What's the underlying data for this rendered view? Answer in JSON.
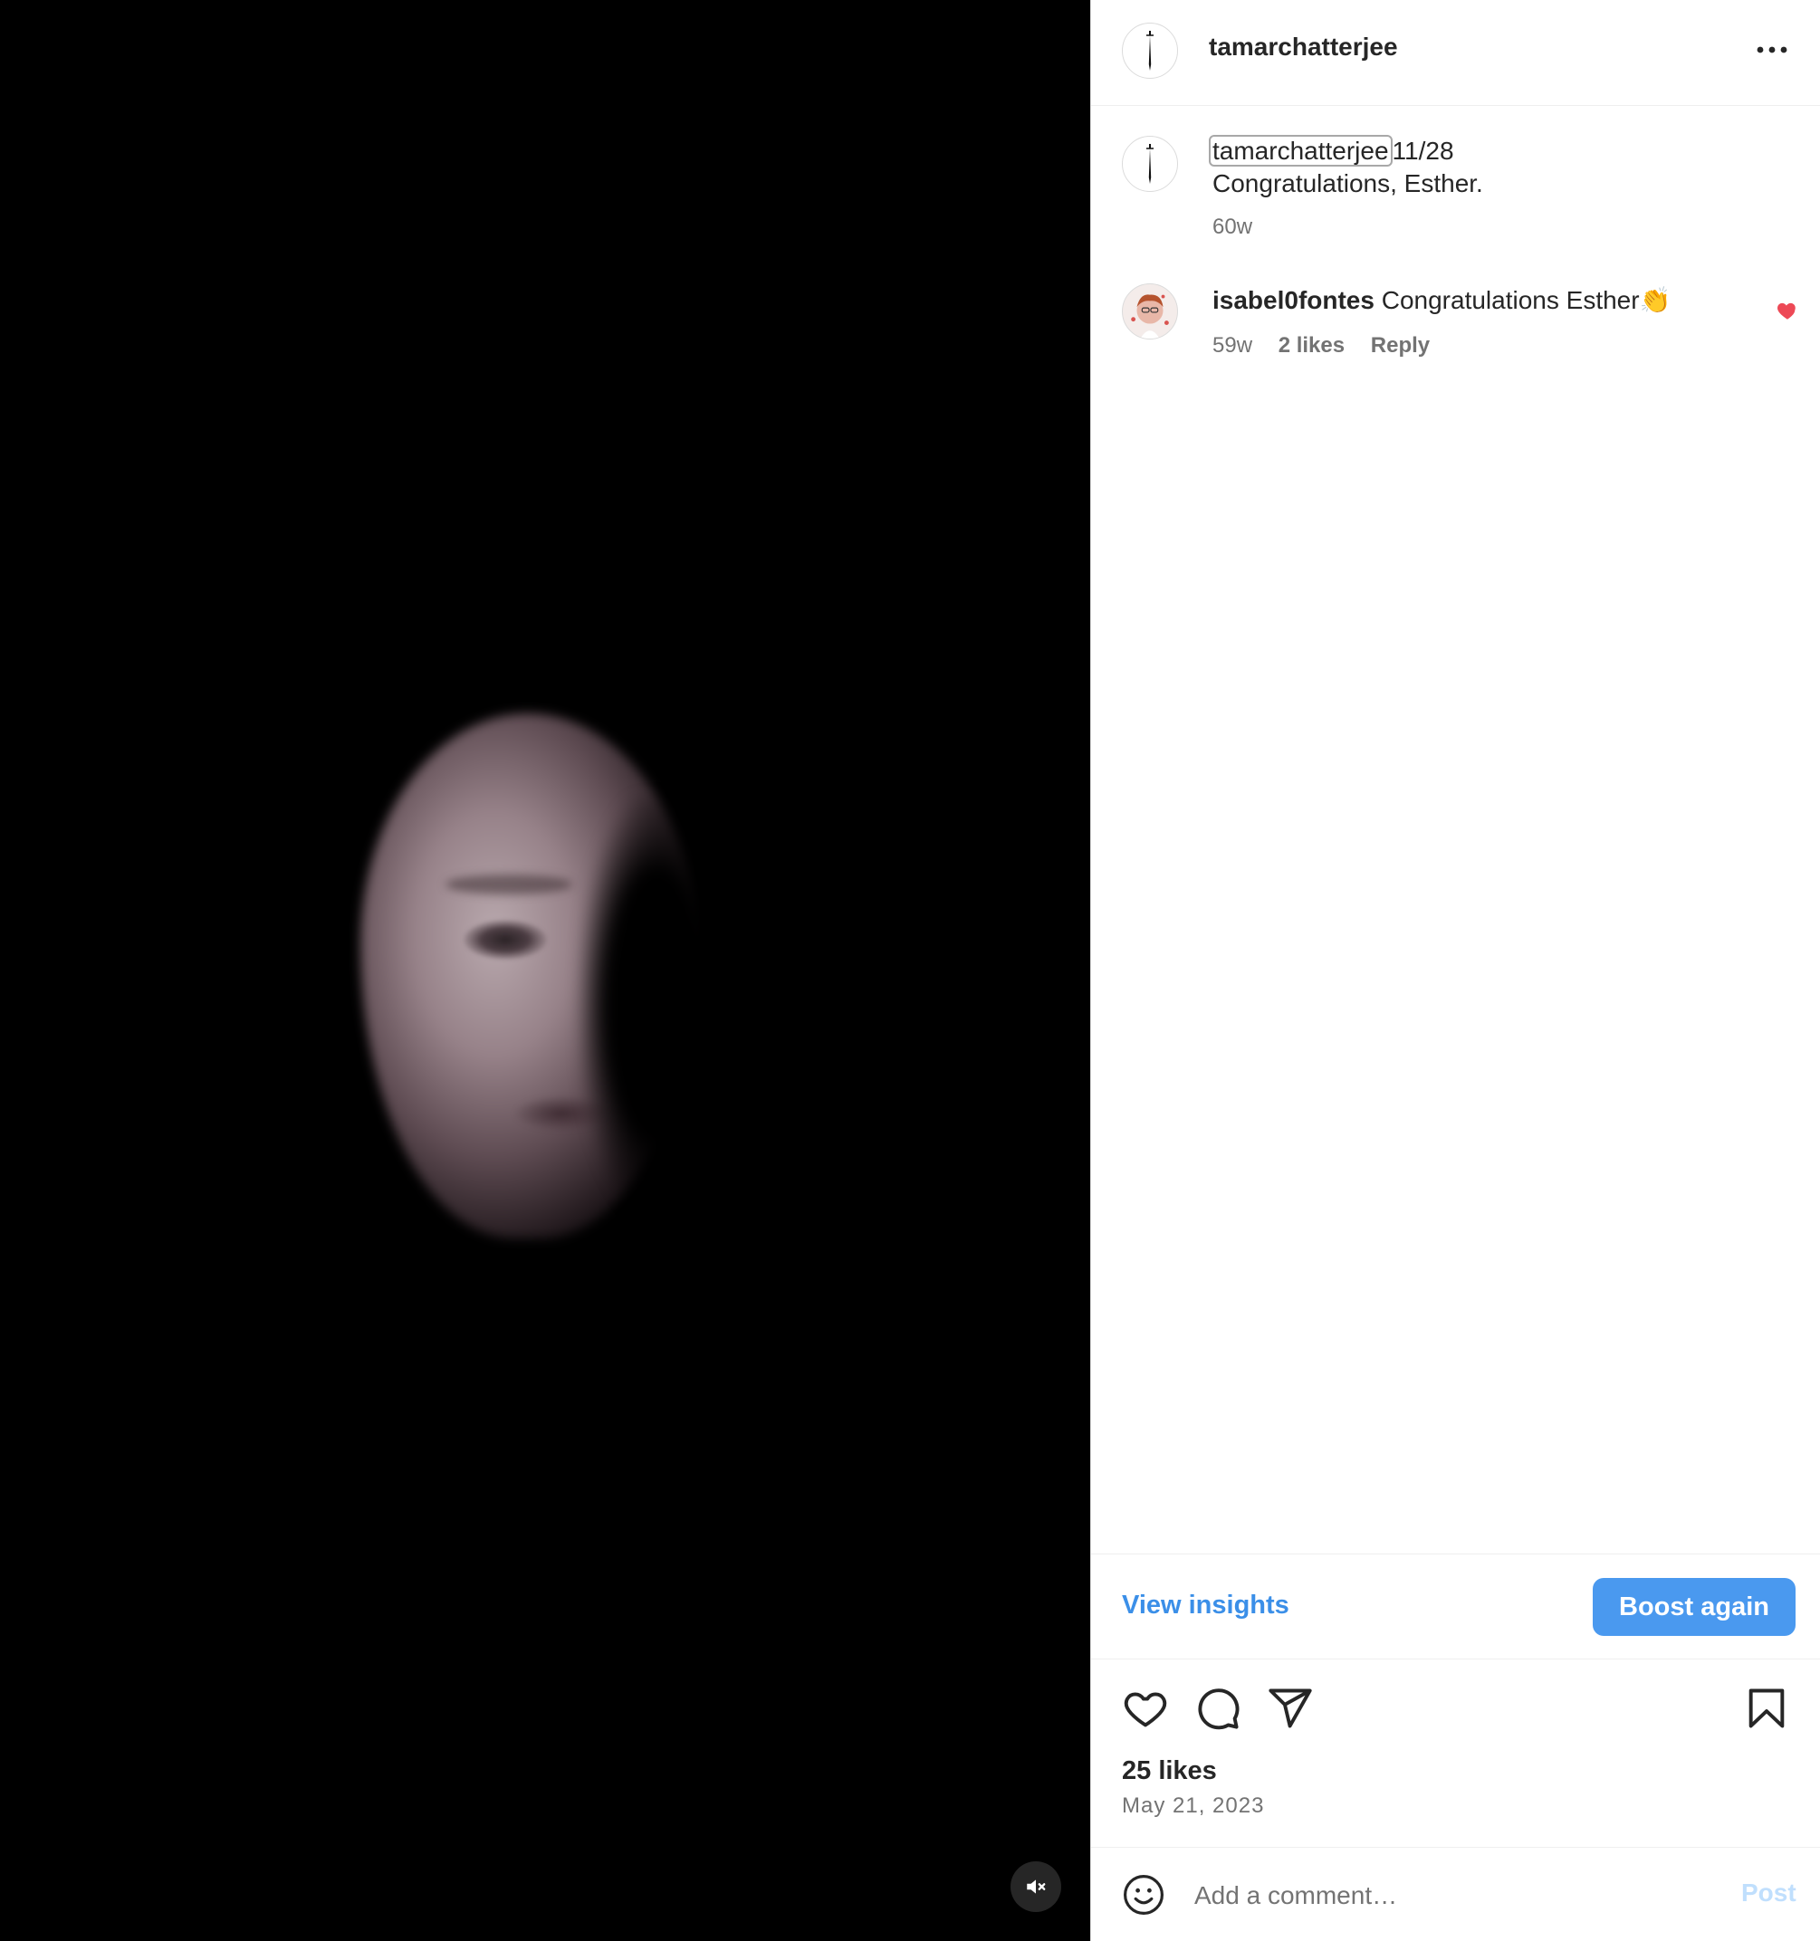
{
  "header": {
    "username": "tamarchatterjee",
    "more_icon": "more-horizontal-icon"
  },
  "caption": {
    "username": "tamarchatterjee",
    "line1": "11/28",
    "line2": "Congratulations, Esther.",
    "time": "60w"
  },
  "comments": [
    {
      "username": "isabel0fontes",
      "text": "Congratulations Esther👏",
      "time": "59w",
      "likes": "2 likes",
      "reply_label": "Reply",
      "liked": true
    }
  ],
  "boost": {
    "view_insights_label": "View insights",
    "boost_again_label": "Boost again"
  },
  "actions": {
    "icons": [
      "heart-icon",
      "comment-icon",
      "share-icon",
      "bookmark-icon"
    ]
  },
  "likes_count": "25 likes",
  "post_date": "May 21, 2023",
  "add_comment": {
    "placeholder": "Add a comment…",
    "post_label": "Post"
  },
  "colors": {
    "accent": "#4a99ef",
    "link": "#3b8fe8",
    "like_red": "#ed4956",
    "muted_text": "#737373"
  },
  "media": {
    "muted": true
  }
}
